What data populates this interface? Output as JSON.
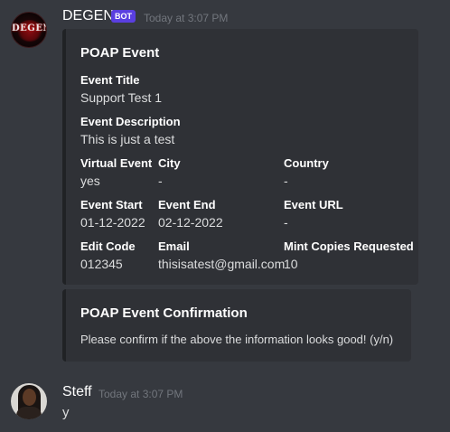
{
  "messages": {
    "bot": {
      "username": "DEGEN",
      "tag": "BOT",
      "timestamp": "Today at 3:07 PM",
      "avatar_text": "DEGEN",
      "embed1": {
        "title": "POAP Event",
        "fields": {
          "event_title": {
            "name": "Event Title",
            "value": "Support Test 1"
          },
          "event_description": {
            "name": "Event Description",
            "value": "This is just a test"
          },
          "virtual_event": {
            "name": "Virtual Event",
            "value": "yes"
          },
          "city": {
            "name": "City",
            "value": "-"
          },
          "country": {
            "name": "Country",
            "value": "-"
          },
          "event_start": {
            "name": "Event Start",
            "value": "01-12-2022"
          },
          "event_end": {
            "name": "Event End",
            "value": "02-12-2022"
          },
          "event_url": {
            "name": "Event URL",
            "value": "-"
          },
          "edit_code": {
            "name": "Edit Code",
            "value": "012345"
          },
          "email": {
            "name": "Email",
            "value": "thisisatest@gmail.com"
          },
          "mint_copies": {
            "name": "Mint Copies Requested",
            "value": "10"
          }
        }
      },
      "embed2": {
        "title": "POAP Event Confirmation",
        "description": "Please confirm if the above the information looks good! (y/n)"
      }
    },
    "user": {
      "username": "Steff",
      "timestamp": "Today at 3:07 PM",
      "text": "y"
    }
  },
  "colors": {
    "background": "#36393f",
    "embed_bg": "#2f3136",
    "bot_tag": "#5a3fe0",
    "username": "#ffffff",
    "timestamp": "#72767d"
  }
}
